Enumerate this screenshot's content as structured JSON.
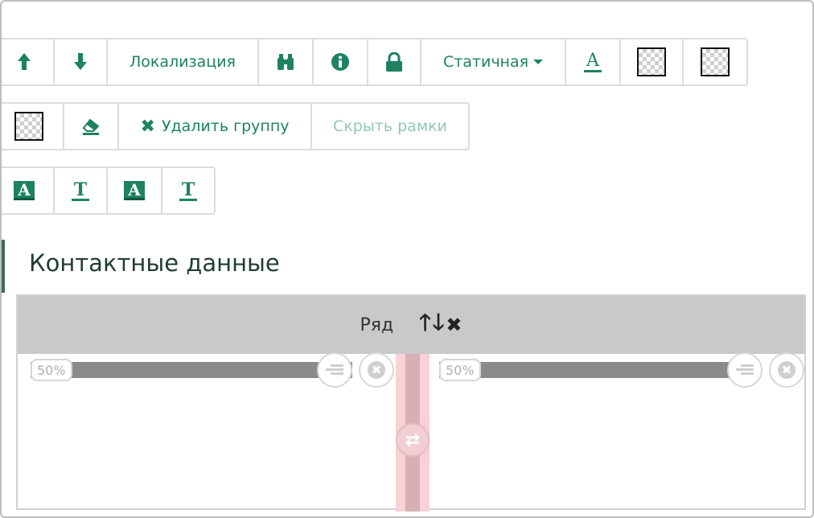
{
  "toolbar_row1": {
    "localization_label": "Локализация",
    "static_label": "Статичная",
    "text_color_glyph": "A"
  },
  "toolbar_row2": {
    "delete_group_label": "Удалить группу",
    "hide_frames_label": "Скрыть рамки"
  },
  "toolbar_row3": {
    "glyph_a1": "A",
    "glyph_t1": "T",
    "glyph_a2": "A",
    "glyph_t2": "T"
  },
  "section": {
    "title": "Контактные данные"
  },
  "grid": {
    "row_label": "Ряд",
    "columns": [
      {
        "width_label": "50%"
      },
      {
        "width_label": "50%"
      }
    ]
  },
  "colors": {
    "accent": "#1e8262",
    "header_bg": "#c9c9c9",
    "splitter": "#f8d2d6"
  }
}
